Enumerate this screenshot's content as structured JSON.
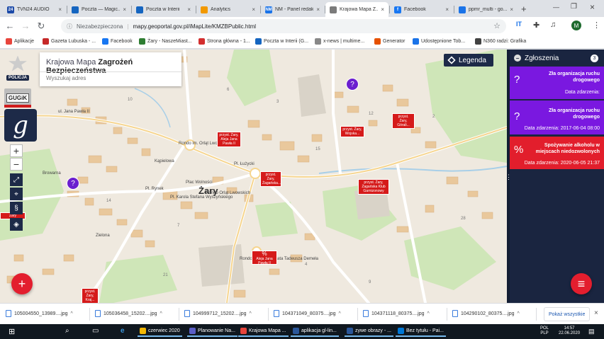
{
  "browser": {
    "tabs": [
      {
        "title": "TVN24 AUDIO",
        "favicon_color": "#1c4aa8",
        "favicon_text": "24"
      },
      {
        "title": "Poczta — Magic...",
        "favicon_color": "#1565c0",
        "favicon_text": ""
      },
      {
        "title": "Poczta w Interii",
        "favicon_color": "#1565c0",
        "favicon_text": ""
      },
      {
        "title": "Analytics",
        "favicon_color": "#f29900",
        "favicon_text": ""
      },
      {
        "title": "NM - Panel redakc...",
        "favicon_color": "#1a73e8",
        "favicon_text": "NM"
      },
      {
        "title": "Krajowa Mapa Z...",
        "favicon_color": "#7b7b7b",
        "favicon_text": ""
      },
      {
        "title": "Facebook",
        "favicon_color": "#1877f2",
        "favicon_text": "f"
      },
      {
        "title": "ppmr_multi - go...",
        "favicon_color": "#1a73e8",
        "favicon_text": ""
      }
    ],
    "new_tab_icon": "plus-icon",
    "omnibox": {
      "security": "Niezabezpieczona",
      "url": "mapy.geoportal.gov.pl/iMapLite/KMZBPublic.html"
    },
    "profile_initial": "M",
    "bookmarks": [
      {
        "label": "Aplikacje",
        "color": "#e8453c"
      },
      {
        "label": "Gazeta Lubuska - ...",
        "color": "#c62828"
      },
      {
        "label": "Facebook",
        "color": "#1877f2"
      },
      {
        "label": "Żary - NaszeMiast...",
        "color": "#2e7d32"
      },
      {
        "label": "Strona główna - 1...",
        "color": "#d32f2f"
      },
      {
        "label": "Poczta w Interii (G...",
        "color": "#1565c0"
      },
      {
        "label": "x-news | multime...",
        "color": "#888888"
      },
      {
        "label": "Generator",
        "color": "#e65100"
      },
      {
        "label": "Udostępnione Tob...",
        "color": "#1a73e8"
      },
      {
        "label": "N360 radzi: Grafika",
        "color": "#424242"
      }
    ]
  },
  "app": {
    "title_plain": "Krajowa Mapa ",
    "title_bold": "Zagrożeń Bezpieczeństwa",
    "search_placeholder": "Wyszukaj adres",
    "police_label": "POLICJA",
    "gugik_label": "GUGiK",
    "gugik_bar_color": "#d01c1c",
    "legend_label": "Legenda",
    "brand_color": "#1d2a48",
    "accent_red": "#e31e2e",
    "purple": "#7a18e0"
  },
  "map": {
    "town_label": "Żary",
    "street_labels": [
      "Rondo im. Orląt Lwowskich",
      "Pl. Łużycki",
      "Plac Wolności",
      "Pl. Rynek",
      "Pl. Karola Stefana Wyszyńskiego",
      "Rondo Księdza Prałata Tadeusza Demeła",
      "ul. Jana Pawła II",
      "Kąpielowa",
      "Zielona",
      "Browarna",
      "Rondo Orląt Lwowskich"
    ],
    "markers_red": [
      "przyst. Żary, Aleja Jana Pawła II",
      "przyst. Żary, Górali...",
      "przyst. Żary, Wojska...",
      "przyst. Żary, Żagańska...",
      "przyst. Żary, Żagańska Klub Garnizonowy",
      "Aleja Jana Pawła II",
      "przyst. Żary, Kraj..."
    ],
    "left_edge_tag": "Żary",
    "markers_purple_icon": "car-question-icon"
  },
  "panel": {
    "title": "Zgłoszenia",
    "count": "3",
    "items": [
      {
        "title": "Zła organizacja ruchu drogowego",
        "date": "Data zdarzenia:",
        "color": "#7a18e0",
        "icon": "car-question-icon"
      },
      {
        "title": "Zła organizacja ruchu drogowego",
        "date": "Data zdarzenia: 2017-06-04 08:00",
        "color": "#7a18e0",
        "icon": "car-question-icon"
      },
      {
        "title": "Spożywanie alkoholu w miejscach niedozwolonych",
        "date": "Data zdarzenia: 2020-06-05 21:37",
        "color": "#e21e2c",
        "icon": "bottle-percent-icon"
      }
    ]
  },
  "downloads": {
    "items": [
      "105004550_13989....jpg",
      "105036458_15202....jpg",
      "104999712_15202....jpg",
      "104371049_80375....jpg",
      "104371118_80375....jpg",
      "104290102_80375....jpg"
    ],
    "show_all": "Pokaż wszystkie"
  },
  "taskbar": {
    "apps": [
      {
        "label": "czerwiec 2020",
        "color": "#f2b705"
      },
      {
        "label": "Planowanie Na...",
        "color": "#5b5fc7"
      },
      {
        "label": "Krajowa Mapa ...",
        "color": "#e8453c"
      },
      {
        "label": "aplikacja gl-lin...",
        "color": "#2b579a"
      },
      {
        "label": "zywe obrazy - ...",
        "color": "#2b579a"
      },
      {
        "label": "Bez tytułu - Pai...",
        "color": "#0078d7"
      }
    ],
    "lang": "POL",
    "layout": "PLP",
    "time": "14:57",
    "date": "22.06.2020"
  }
}
